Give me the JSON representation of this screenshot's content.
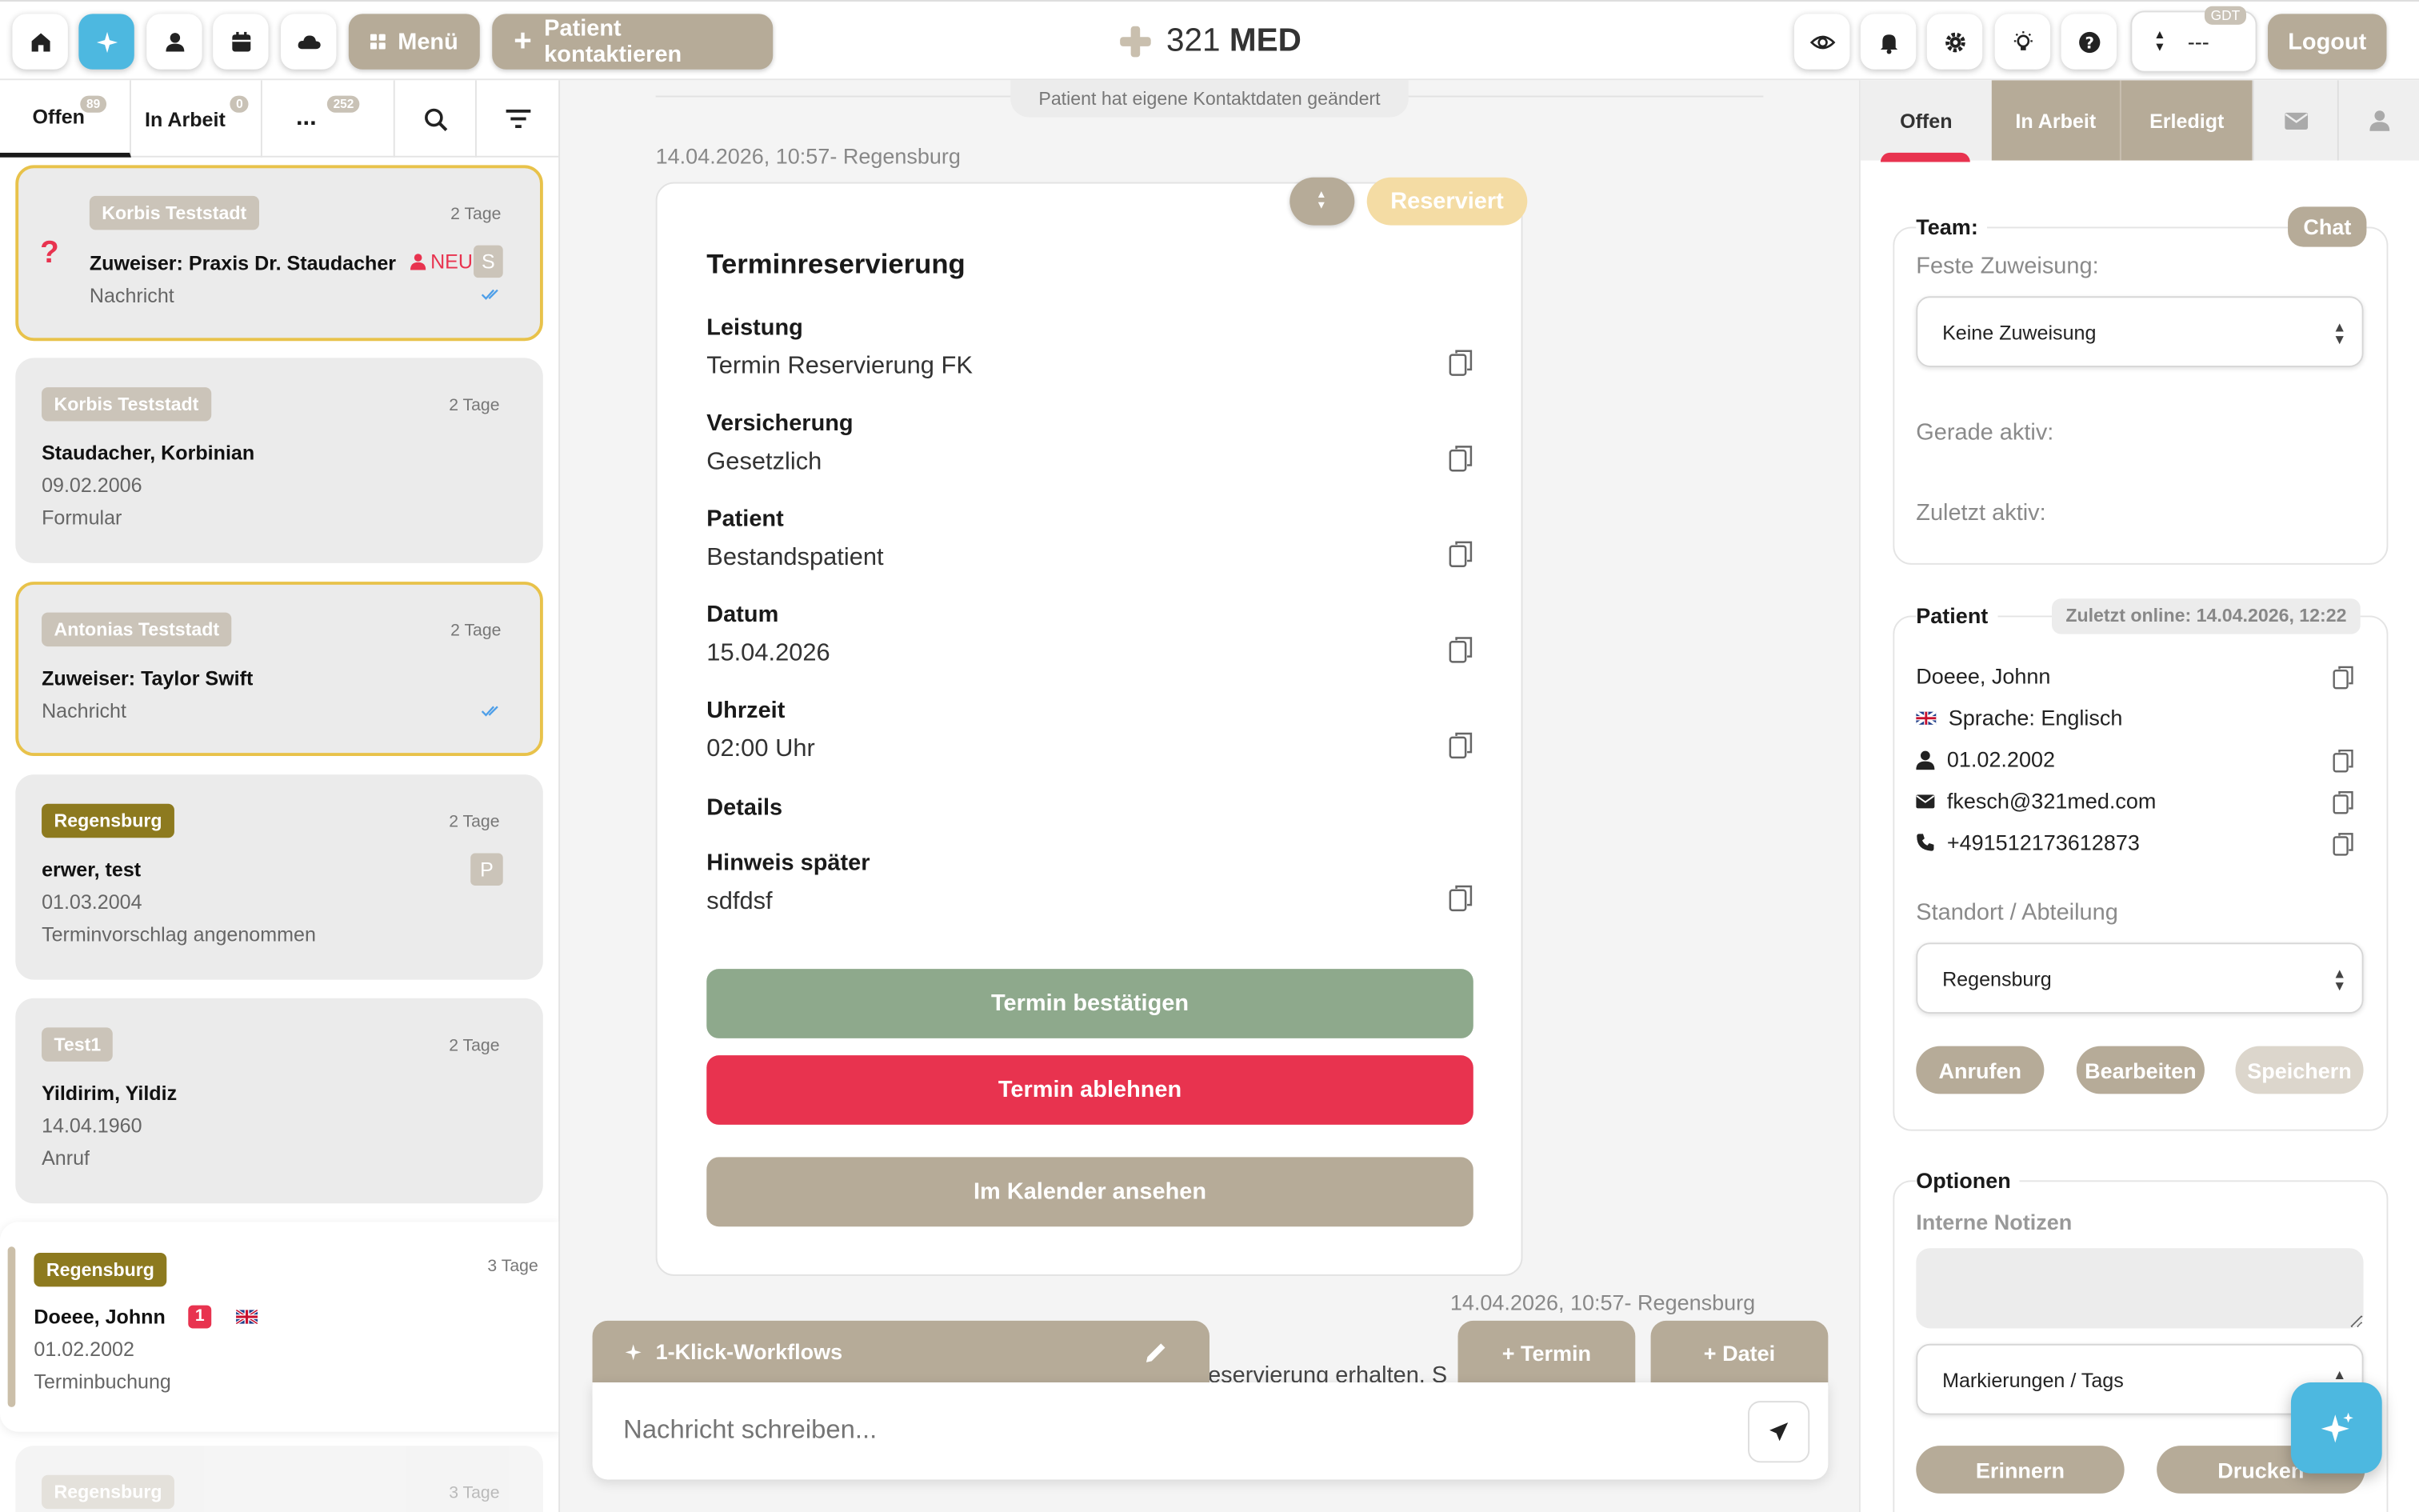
{
  "topbar": {
    "menu_label": "Menü",
    "contact_label": "Patient kontaktieren",
    "logo_light": "321",
    "logo_bold": "MED",
    "gdt_value": "---",
    "gdt_badge": "GDT",
    "logout_label": "Logout"
  },
  "left_tabs": [
    {
      "label": "Offen",
      "count": "89"
    },
    {
      "label": "In Arbeit",
      "count": "0"
    },
    {
      "label": "...",
      "count": "252"
    }
  ],
  "conversations": [
    {
      "tag": "Korbis Teststadt",
      "age": "2 Tage",
      "name": "Zuweiser: Praxis Dr. Staudacher",
      "line2": "Nachricht",
      "new_label": "NEU",
      "initial": "S"
    },
    {
      "tag": "Korbis Teststadt",
      "age": "2 Tage",
      "name": "Staudacher, Korbinian",
      "line2": "09.02.2006",
      "line3": "Formular"
    },
    {
      "tag": "Antonias Teststadt",
      "age": "2 Tage",
      "name": "Zuweiser: Taylor Swift",
      "line2": "Nachricht"
    },
    {
      "tag": "Regensburg",
      "age": "2 Tage",
      "name": "erwer, test",
      "line2": "01.03.2004",
      "line3": "Terminvorschlag angenommen",
      "initial": "P"
    },
    {
      "tag": "Test1",
      "age": "2 Tage",
      "name": "Yildirim, Yildiz",
      "line2": "14.04.1960",
      "line3": "Anruf"
    },
    {
      "tag": "Regensburg",
      "age": "3 Tage",
      "name": "Doeee, Johnn",
      "line2": "01.02.2002",
      "line3": "Terminbuchung",
      "unread": "1"
    },
    {
      "tag": "Regensburg",
      "age": "3 Tage"
    }
  ],
  "chat": {
    "system_note": "Patient hat eigene Kontaktdaten geändert",
    "timestamp1": "14.04.2026, 10:57- Regensburg",
    "status_badge": "Reserviert",
    "card_title": "Terminreservierung",
    "fields": [
      {
        "label": "Leistung",
        "value": "Termin Reservierung FK"
      },
      {
        "label": "Versicherung",
        "value": "Gesetzlich"
      },
      {
        "label": "Patient",
        "value": "Bestandspatient"
      },
      {
        "label": "Datum",
        "value": "15.04.2026"
      },
      {
        "label": "Uhrzeit",
        "value": "02:00 Uhr"
      },
      {
        "label": "Details",
        "value": ""
      },
      {
        "label": "Hinweis später",
        "value": "sdfdsf"
      }
    ],
    "confirm_label": "Termin bestätigen",
    "reject_label": "Termin ablehnen",
    "calendar_label": "Im Kalender ansehen",
    "timestamp2": "14.04.2026, 10:57- Regensburg",
    "partial_message": "eservierung erhalten. S",
    "workflows_label": "1-Klick-Workflows",
    "termin_btn": "+ Termin",
    "datei_btn": "+ Datei",
    "compose_placeholder": "Nachricht schreiben..."
  },
  "right": {
    "tabs": [
      "Offen",
      "In Arbeit",
      "Erledigt"
    ],
    "team": {
      "title": "Team:",
      "chat_label": "Chat",
      "fixed_label": "Feste Zuweisung:",
      "fixed_value": "Keine Zuweisung",
      "active_label": "Gerade aktiv:",
      "last_label": "Zuletzt aktiv:"
    },
    "patient": {
      "title": "Patient",
      "online": "Zuletzt online: 14.04.2026, 12:22",
      "name": "Doeee, Johnn",
      "language": "Sprache: Englisch",
      "dob": "01.02.2002",
      "email": "fkesch@321med.com",
      "phone": "+491512173612873",
      "location_label": "Standort / Abteilung",
      "location_value": "Regensburg",
      "call_label": "Anrufen",
      "edit_label": "Bearbeiten",
      "save_label": "Speichern"
    },
    "options": {
      "title": "Optionen",
      "notes_label": "Interne Notizen",
      "tags_label": "Markierungen / Tags",
      "remind_label": "Erinnern",
      "print_label": "Drucken"
    }
  },
  "colors": {
    "taupe": "#b6ab98",
    "green": "#8ea98c",
    "red": "#e8334f",
    "olive": "#8d7a1f",
    "accent_blue": "#4db8e0",
    "gold_border": "#e8c24a"
  }
}
